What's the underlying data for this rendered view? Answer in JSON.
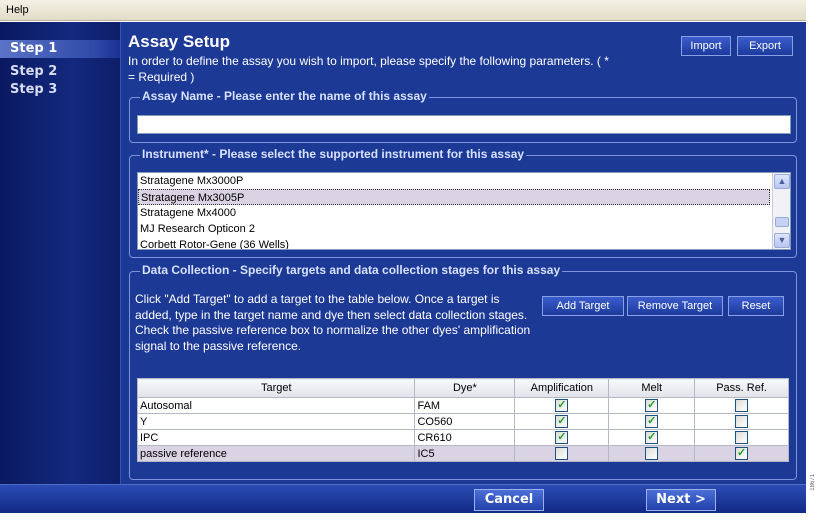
{
  "menubar": {
    "help_label": "Help"
  },
  "sidebar": {
    "steps": [
      {
        "label": "Step 1"
      },
      {
        "label": "Step 2"
      },
      {
        "label": "Step 3"
      }
    ]
  },
  "header": {
    "title": "Assay Setup",
    "intro": "In order to define the assay you wish to import, please specify the following parameters. ( * = Required )",
    "import_label": "Import",
    "export_label": "Export"
  },
  "assay_name": {
    "legend": "Assay Name - Please enter the name of this assay",
    "value": ""
  },
  "instrument": {
    "legend": "Instrument* - Please select the supported instrument for this assay",
    "items": [
      "Stratagene Mx3000P",
      "Stratagene Mx3005P",
      "Stratagene Mx4000",
      "MJ Research Opticon 2",
      "Corbett Rotor-Gene (36 Wells)"
    ],
    "selected": "Stratagene Mx3005P",
    "scroll_up_icon": "arrow-up-icon",
    "scroll_down_icon": "arrow-down-icon"
  },
  "data_collection": {
    "legend": "Data Collection - Specify targets and data collection stages for this assay",
    "description": "Click \"Add Target\" to add a target to the table below.  Once a target is added, type in the target name and dye then select data collection stages. Check the passive reference box to normalize the other dyes' amplification signal to the passive reference.",
    "add_target_label": "Add Target",
    "remove_target_label": "Remove Target",
    "reset_label": "Reset",
    "columns": [
      "Target",
      "Dye*",
      "Amplification",
      "Melt",
      "Pass. Ref."
    ],
    "rows": [
      {
        "target": "Autosomal",
        "dye": "FAM",
        "amplification": true,
        "melt": true,
        "pass_ref": false
      },
      {
        "target": "Y",
        "dye": "CO560",
        "amplification": true,
        "melt": true,
        "pass_ref": false
      },
      {
        "target": "IPC",
        "dye": "CR610",
        "amplification": true,
        "melt": true,
        "pass_ref": false
      },
      {
        "target": "passive reference",
        "dye": "IC5",
        "amplification": false,
        "melt": false,
        "pass_ref": true
      }
    ]
  },
  "footer": {
    "cancel_label": "Cancel",
    "next_label": "Next >"
  },
  "side_code": "18671"
}
